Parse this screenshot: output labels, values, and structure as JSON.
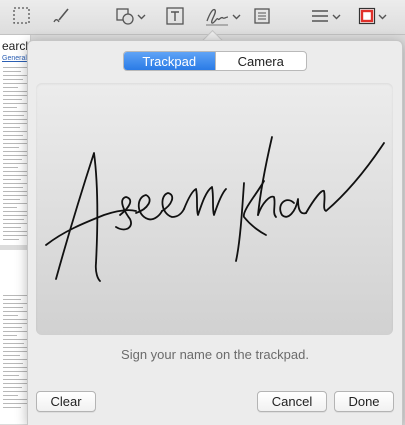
{
  "tabs": [
    {
      "label": "Trackpad",
      "active": true
    },
    {
      "label": "Camera",
      "active": false
    }
  ],
  "hint": "Sign your name on the trackpad.",
  "buttons": {
    "clear": "Clear",
    "cancel": "Cancel",
    "done": "Done"
  },
  "document": {
    "title_fragment": "earch",
    "link_fragment": "General"
  },
  "icons": [
    "selection-icon",
    "sketch-icon",
    "shapes-icon",
    "text-box-icon",
    "signature-icon",
    "note-icon",
    "line-style-icon",
    "border-color-icon"
  ],
  "colors": {
    "accent": "#2a7be6",
    "border_color_swatch": "#e0302a"
  }
}
